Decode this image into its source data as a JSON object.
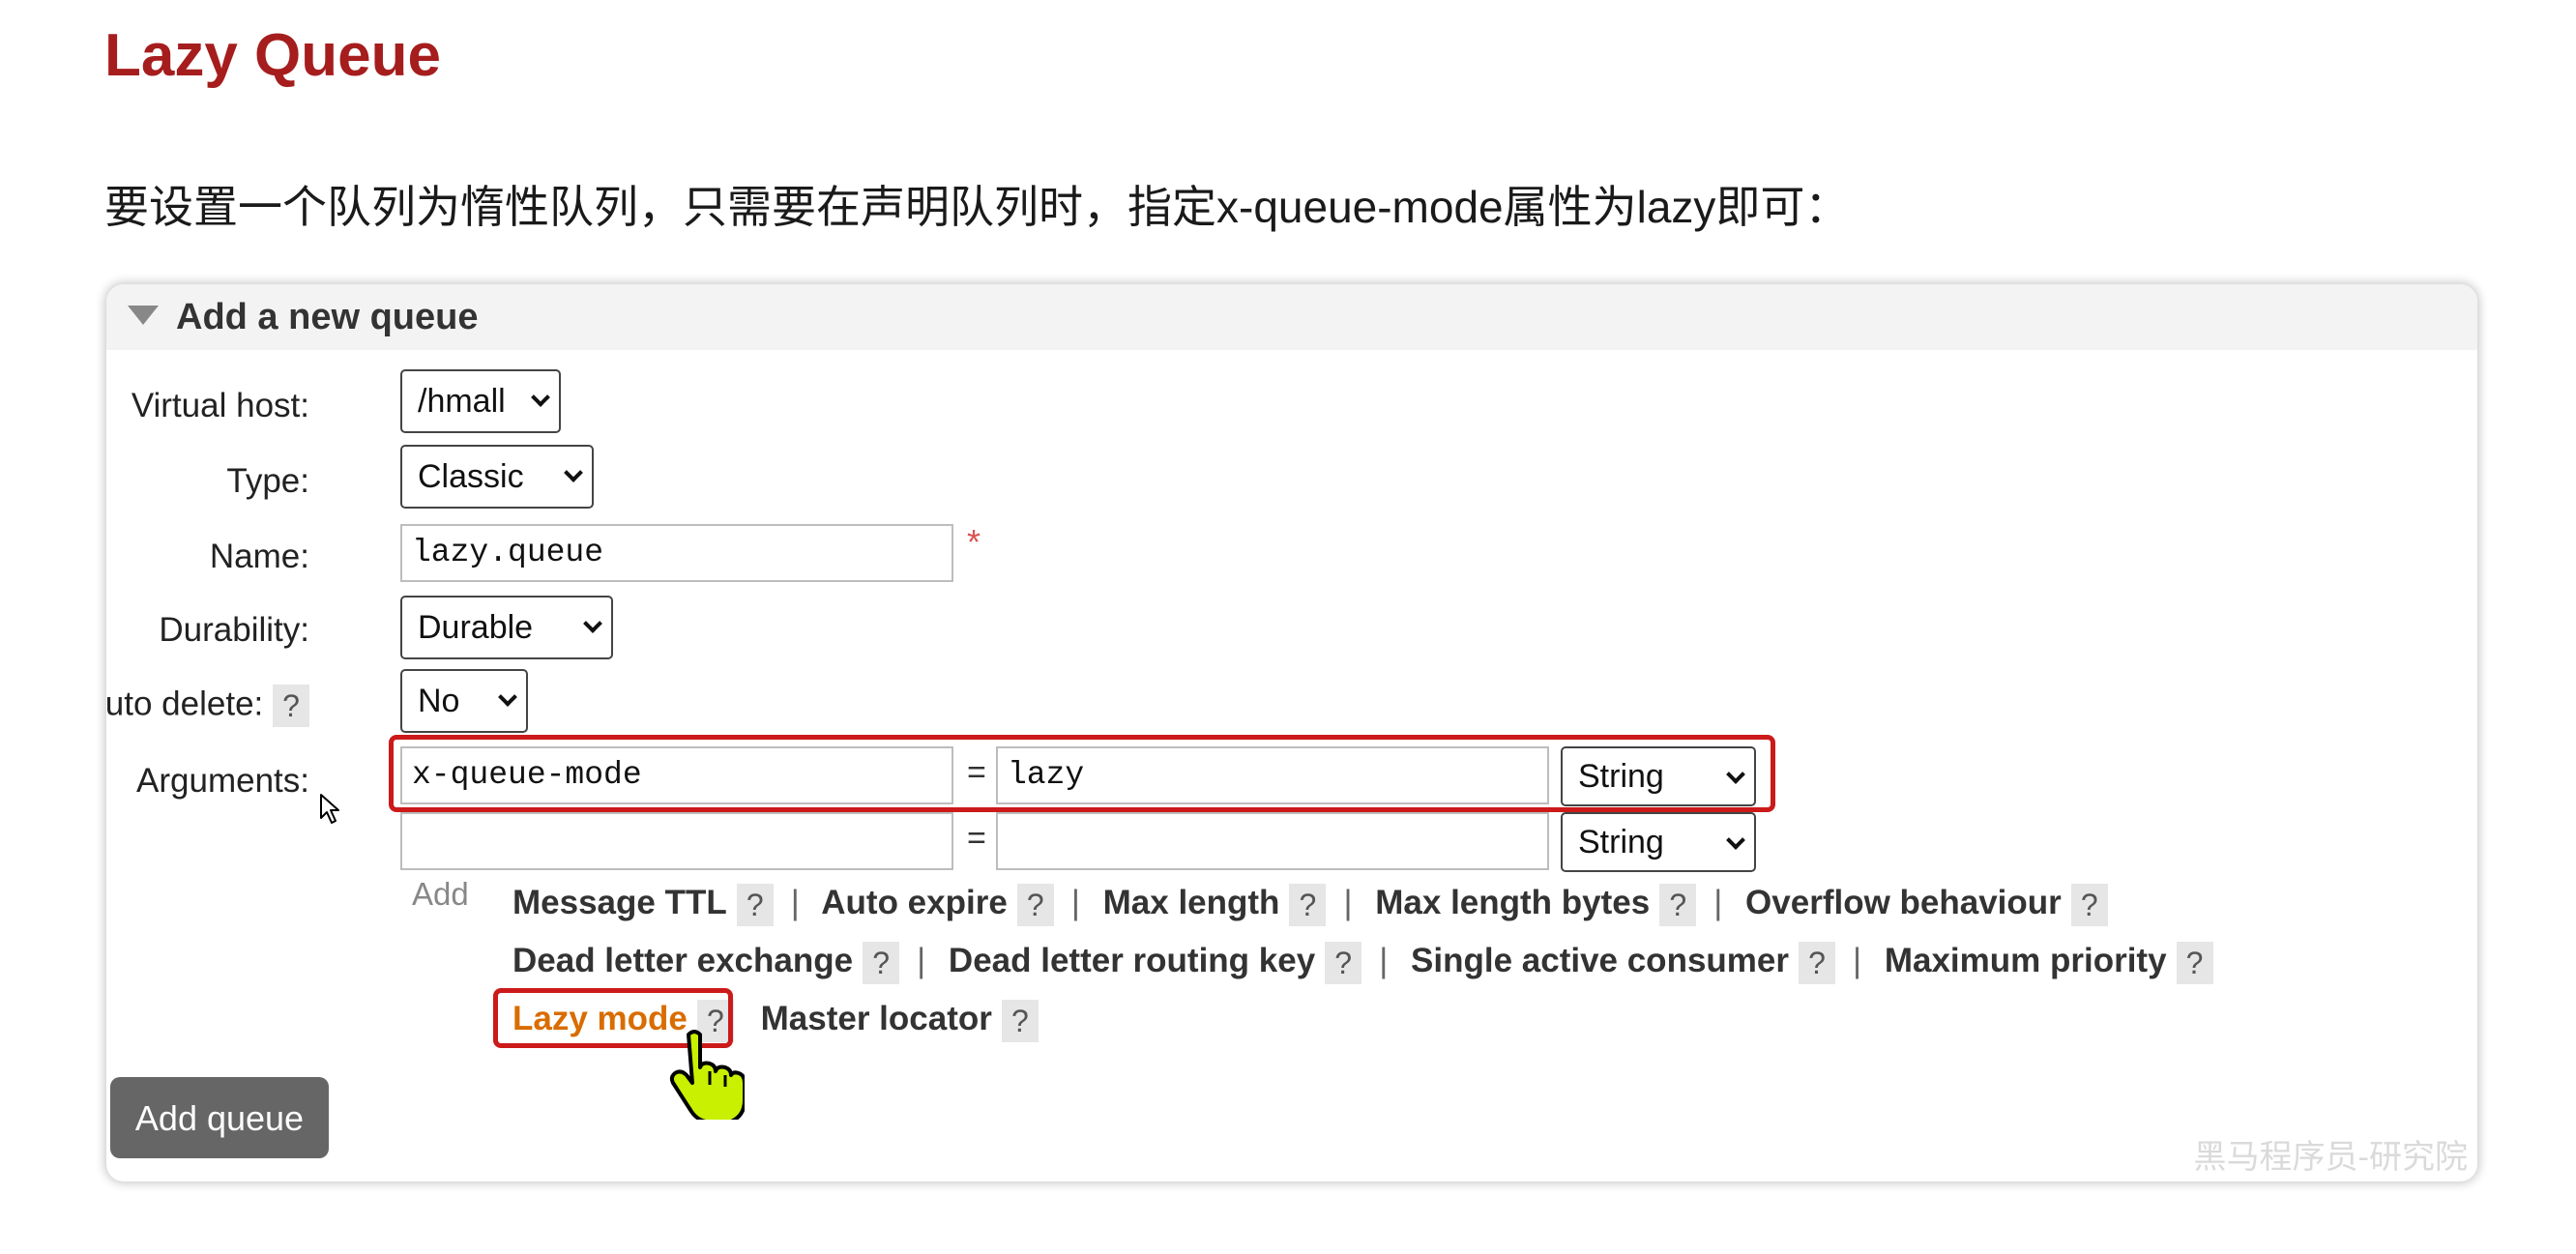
{
  "heading": "Lazy Queue",
  "intro": "要设置一个队列为惰性队列，只需要在声明队列时，指定x-queue-mode属性为lazy即可：",
  "panel": {
    "title": "Add a new queue",
    "virtual_host": {
      "label": "Virtual host:",
      "value": "/hmall"
    },
    "type": {
      "label": "Type:",
      "value": "Classic"
    },
    "name": {
      "label": "Name:",
      "value": "lazy.queue",
      "required_mark": "*"
    },
    "durability": {
      "label": "Durability:",
      "value": "Durable"
    },
    "auto_delete": {
      "label": "Auto delete:",
      "help": "?",
      "value": "No"
    },
    "arguments": {
      "label": "Arguments:",
      "rows": [
        {
          "key": "x-queue-mode",
          "eq": "=",
          "value": "lazy",
          "type": "String"
        },
        {
          "key": "",
          "eq": "=",
          "value": "",
          "type": "String"
        }
      ]
    },
    "add_label": "Add",
    "help": "?",
    "separator": "|",
    "links_row1": [
      "Message TTL",
      "Auto expire",
      "Max length",
      "Max length bytes",
      "Overflow behaviour"
    ],
    "links_row2": [
      "Dead letter exchange",
      "Dead letter routing key",
      "Single active consumer",
      "Maximum priority"
    ],
    "links_row3": [
      "Lazy mode",
      "Master locator"
    ],
    "add_queue_button": "Add queue",
    "watermark": "黑马程序员-研究院"
  },
  "colors": {
    "heading": "#a61d1d",
    "highlight_border": "#cc1a1a",
    "lazy_link": "#d96c00",
    "button_bg": "#666666"
  },
  "icons": {
    "collapse": "caret-down-icon",
    "select": "chevron-down-icon",
    "cursor": "hand-pointer-icon"
  }
}
